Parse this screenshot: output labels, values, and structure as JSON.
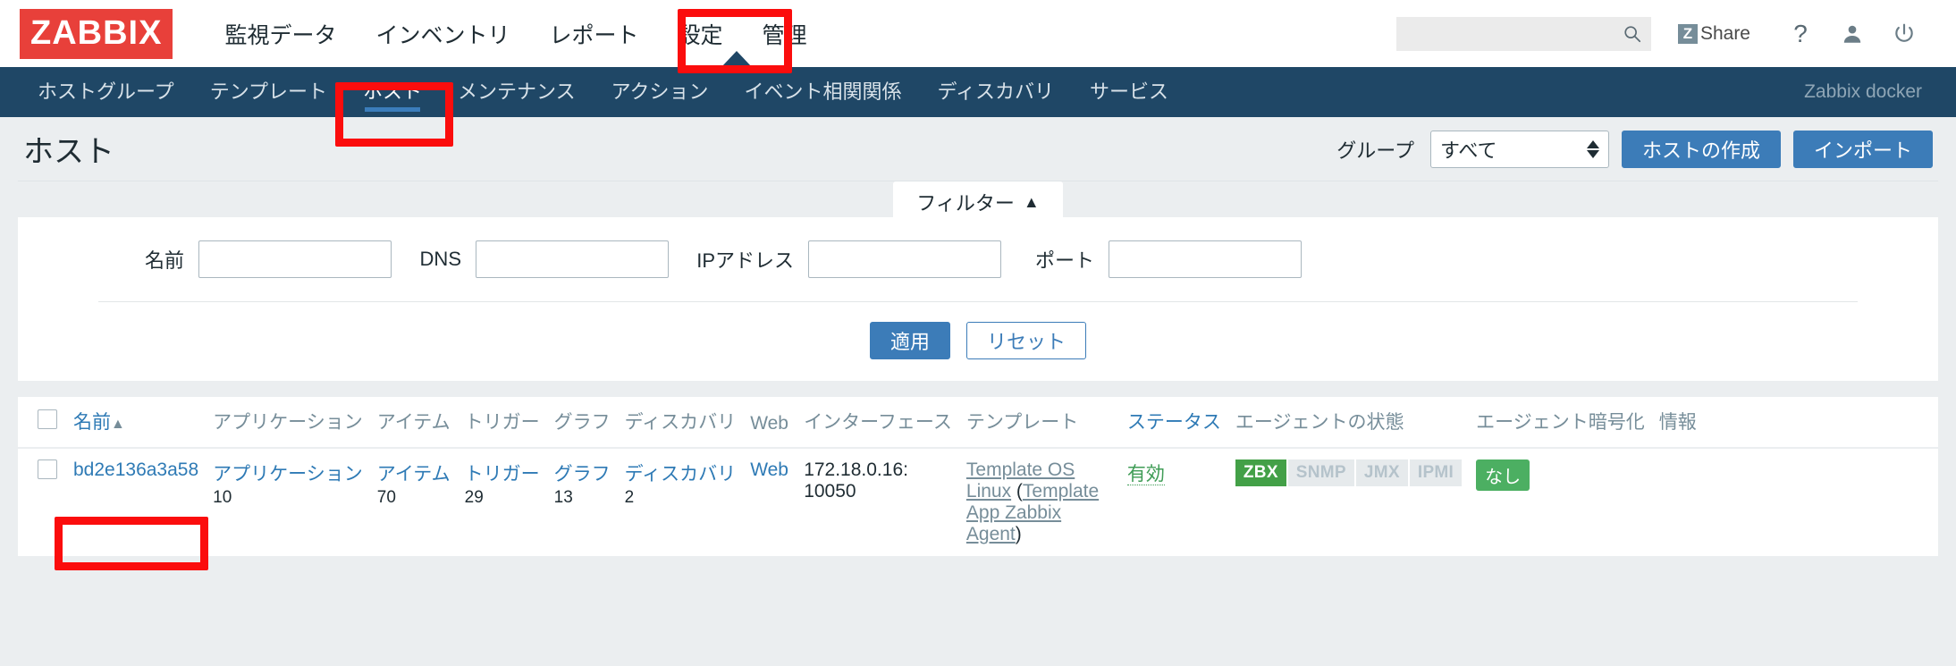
{
  "brand": {
    "logo": "ZABBIX",
    "accent": "#e8403a",
    "nav_bg": "#1f4766",
    "link": "#2e7ab5",
    "ok": "#43a047",
    "annotation": "#fb0d0d"
  },
  "header": {
    "menu": [
      {
        "label": "監視データ",
        "selected": false
      },
      {
        "label": "インベントリ",
        "selected": false
      },
      {
        "label": "レポート",
        "selected": false
      },
      {
        "label": "設定",
        "selected": true
      },
      {
        "label": "管理",
        "selected": false
      }
    ],
    "search": {
      "value": "",
      "placeholder": "",
      "icon": "search-icon"
    },
    "share": {
      "label": "Share",
      "badge": "Z"
    },
    "help_icon": "?",
    "user_icon": "user-icon",
    "signout_icon": "power-icon"
  },
  "subnav": {
    "items": [
      {
        "label": "ホストグループ",
        "active": false
      },
      {
        "label": "テンプレート",
        "active": false
      },
      {
        "label": "ホスト",
        "active": true
      },
      {
        "label": "メンテナンス",
        "active": false
      },
      {
        "label": "アクション",
        "active": false
      },
      {
        "label": "イベント相関関係",
        "active": false
      },
      {
        "label": "ディスカバリ",
        "active": false
      },
      {
        "label": "サービス",
        "active": false
      }
    ],
    "user": "Zabbix docker"
  },
  "page": {
    "title": "ホスト",
    "group_label": "グループ",
    "group_value": "すべて",
    "create_host_button": "ホストの作成",
    "import_button": "インポート"
  },
  "filter": {
    "tab_label": "フィルター",
    "tab_caret": "▲",
    "fields": [
      {
        "label": "名前",
        "value": "",
        "placeholder": ""
      },
      {
        "label": "DNS",
        "value": "",
        "placeholder": ""
      },
      {
        "label": "IPアドレス",
        "value": "",
        "placeholder": ""
      },
      {
        "label": "ポート",
        "value": "",
        "placeholder": ""
      }
    ],
    "apply_button": "適用",
    "reset_button": "リセット"
  },
  "table": {
    "columns": [
      {
        "label": "",
        "kind": "checkbox"
      },
      {
        "label": "名前",
        "kind": "link",
        "sort": "▲"
      },
      {
        "label": "アプリケーション",
        "kind": "plain"
      },
      {
        "label": "アイテム",
        "kind": "plain"
      },
      {
        "label": "トリガー",
        "kind": "plain"
      },
      {
        "label": "グラフ",
        "kind": "plain"
      },
      {
        "label": "ディスカバリ",
        "kind": "plain"
      },
      {
        "label": "Web",
        "kind": "plain"
      },
      {
        "label": "インターフェース",
        "kind": "plain"
      },
      {
        "label": "テンプレート",
        "kind": "plain"
      },
      {
        "label": "ステータス",
        "kind": "link"
      },
      {
        "label": "エージェントの状態",
        "kind": "plain"
      },
      {
        "label": "エージェント暗号化",
        "kind": "plain"
      },
      {
        "label": "情報",
        "kind": "plain"
      }
    ],
    "rows": [
      {
        "name": "bd2e136a3a58",
        "application_label": "アプリケーション",
        "application_count": "10",
        "item_label": "アイテム",
        "item_count": "70",
        "trigger_label": "トリガー",
        "trigger_count": "29",
        "graph_label": "グラフ",
        "graph_count": "13",
        "discovery_label": "ディスカバリ",
        "discovery_count": "2",
        "web_label": "Web",
        "interface": "172.18.0.16: 10050",
        "template": "Template OS Linux (Template App Zabbix Agent)",
        "template_links": [
          "Template OS Linux",
          "Template App Zabbix Agent"
        ],
        "status": "有効",
        "agent_badges": [
          {
            "label": "ZBX",
            "active": true
          },
          {
            "label": "SNMP",
            "active": false
          },
          {
            "label": "JMX",
            "active": false
          },
          {
            "label": "IPMI",
            "active": false
          }
        ],
        "encryption": "なし",
        "info": ""
      }
    ]
  },
  "annotations": [
    {
      "name": "annotation-settings-menu",
      "target": "設定"
    },
    {
      "name": "annotation-hosts-subnav",
      "target": "ホスト"
    },
    {
      "name": "annotation-host-name-cell",
      "target": "bd2e136a3a58"
    }
  ]
}
